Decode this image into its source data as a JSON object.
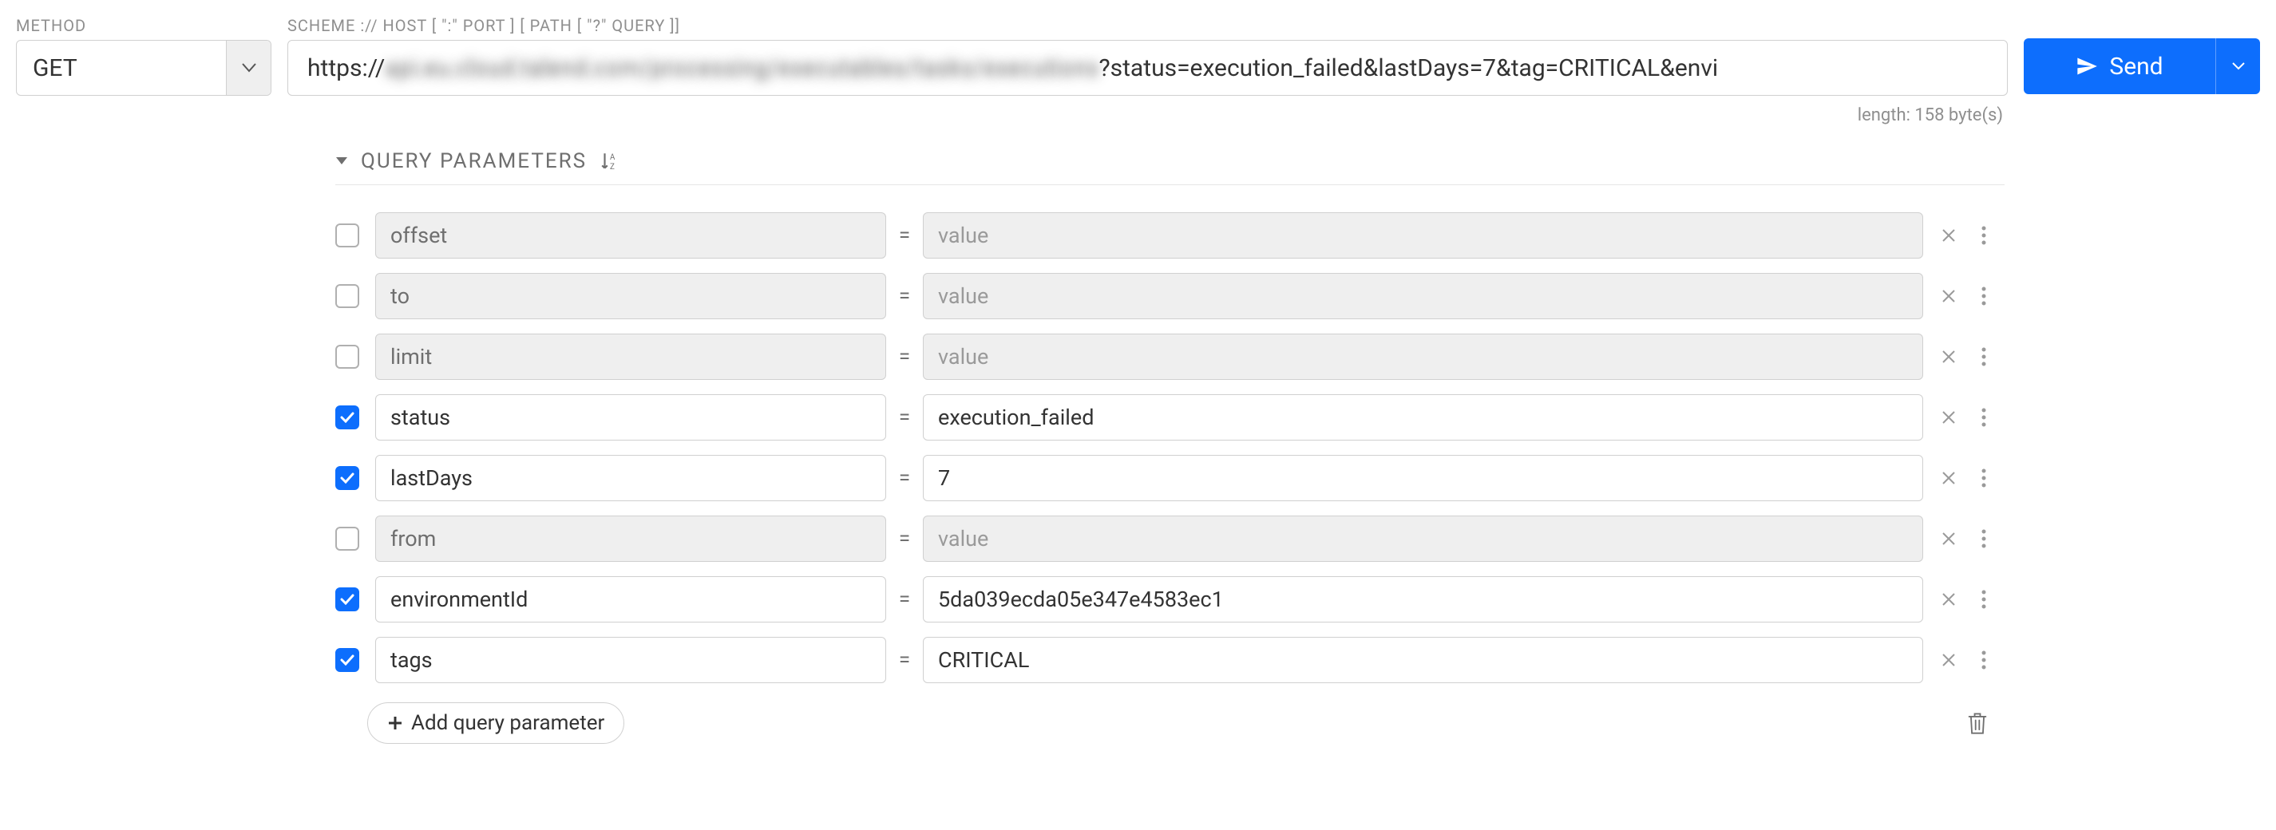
{
  "method": {
    "label": "METHOD",
    "value": "GET"
  },
  "url": {
    "label": "SCHEME :// HOST [ \":\" PORT ] [ PATH [ \"?\" QUERY ]]",
    "prefix": "https://",
    "blurred": "api.eu.cloud.talend.com/processing/executables/tasks/executions",
    "suffix": "?status=execution_failed&lastDays=7&tag=CRITICAL&envi",
    "length_text": "length: 158 byte(s)"
  },
  "send": {
    "label": "Send"
  },
  "query": {
    "title": "QUERY PARAMETERS",
    "add_label": "Add query parameter",
    "value_placeholder": "value",
    "items": [
      {
        "enabled": false,
        "key": "offset",
        "value": ""
      },
      {
        "enabled": false,
        "key": "to",
        "value": ""
      },
      {
        "enabled": false,
        "key": "limit",
        "value": ""
      },
      {
        "enabled": true,
        "key": "status",
        "value": "execution_failed"
      },
      {
        "enabled": true,
        "key": "lastDays",
        "value": "7"
      },
      {
        "enabled": false,
        "key": "from",
        "value": ""
      },
      {
        "enabled": true,
        "key": "environmentId",
        "value": "5da039ecda05e347e4583ec1"
      },
      {
        "enabled": true,
        "key": "tags",
        "value": "CRITICAL"
      }
    ]
  }
}
